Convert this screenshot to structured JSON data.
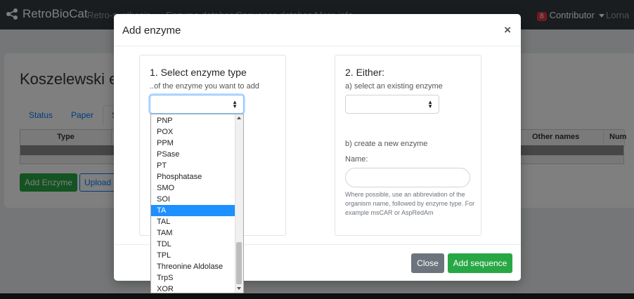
{
  "navbar": {
    "brand": "RetroBioCat",
    "links": [
      "Retro-synthesis",
      "Enzyme database",
      "Sequence database",
      "More info"
    ],
    "badge_count": "8",
    "contributor_label": "Contributor",
    "user": "Lorna"
  },
  "background": {
    "title": "Koszelewski et",
    "tabs": [
      "Status",
      "Paper",
      "Se"
    ],
    "table_headers": [
      "Type",
      "Other names",
      "Num"
    ],
    "add_enzyme_label": "Add Enzyme",
    "upload_label": "Upload"
  },
  "modal": {
    "title": "Add enzyme",
    "close_icon": "×",
    "step1": {
      "heading": "1. Select enzyme type",
      "subheading": "..of the enzyme you want to add",
      "selected_value": ""
    },
    "step2": {
      "heading": "2. Either:",
      "existing_label": "a) select an existing enzyme",
      "existing_value": "",
      "create_label": "b) create a new enzyme",
      "name_label": "Name:",
      "name_value": "",
      "help_text": "Where possible, use an abbreviation of the organism name, followed by enzyme type. For example msCAR or AspRedAm"
    },
    "footer": {
      "close_label": "Close",
      "add_label": "Add sequence"
    }
  },
  "dropdown": {
    "options": [
      "PNP",
      "POX",
      "PPM",
      "PSase",
      "PT",
      "Phosphatase",
      "SMO",
      "SOI",
      "TA",
      "TAL",
      "TAM",
      "TDL",
      "TPL",
      "Threonine Aldolase",
      "TrpS",
      "XOR"
    ],
    "highlighted": "TA"
  },
  "colors": {
    "primary": "#007bff",
    "success": "#28a745",
    "secondary": "#6c757d",
    "highlight": "#1e90ff"
  }
}
